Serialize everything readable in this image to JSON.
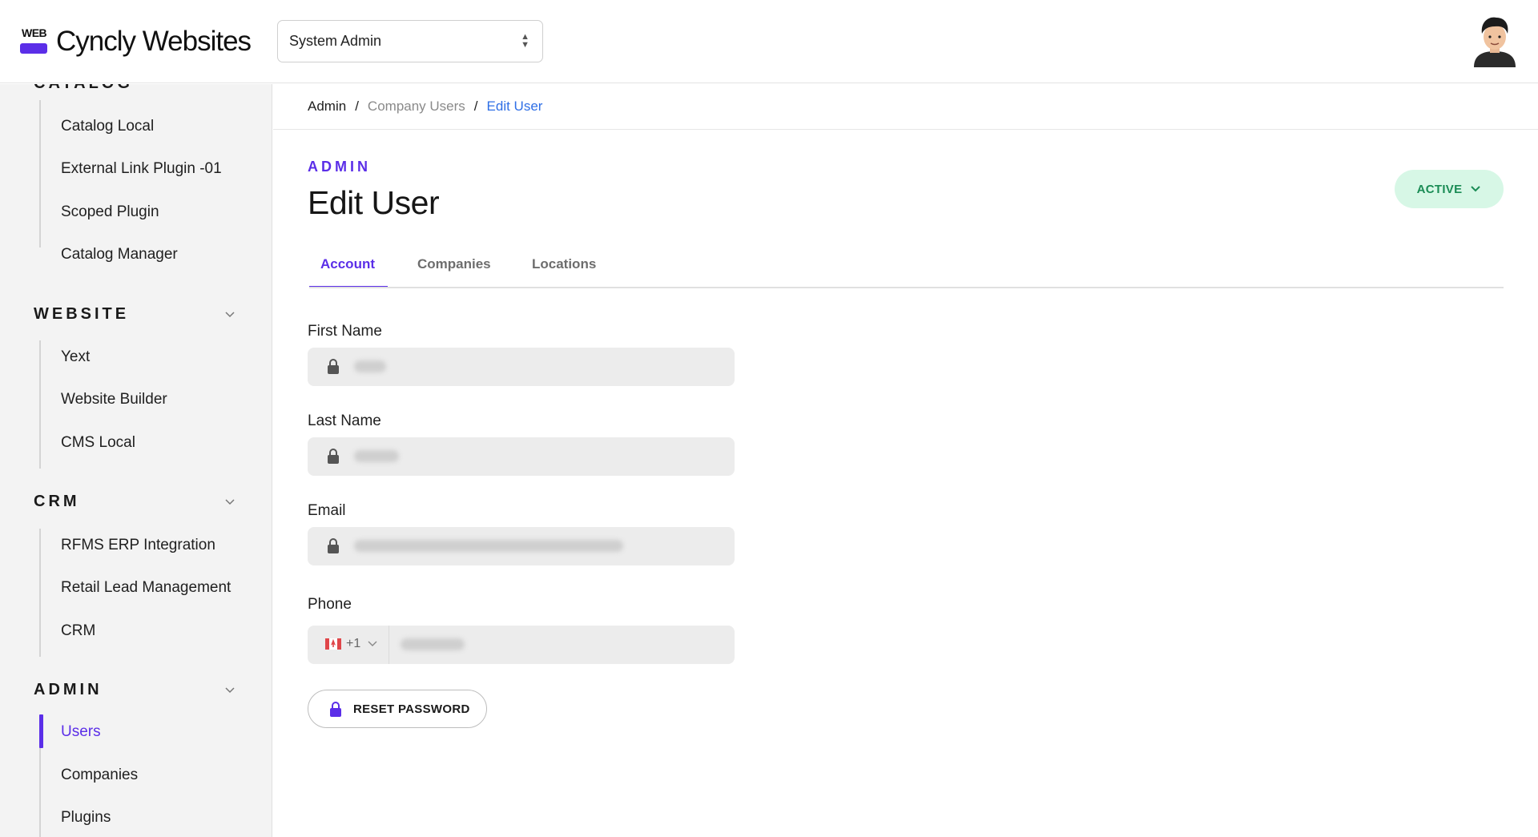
{
  "header": {
    "logo_mark": "WEB",
    "logo_text": "Cyncly Websites",
    "role_select": {
      "value": "System Admin"
    }
  },
  "sidebar": {
    "partial_section": "CATALOG",
    "catalog_items": [
      "Catalog Local",
      "External Link Plugin -01",
      "Scoped Plugin",
      "Catalog Manager"
    ],
    "sections": [
      {
        "title": "WEBSITE",
        "items": [
          "Yext",
          "Website Builder",
          "CMS Local"
        ]
      },
      {
        "title": "CRM",
        "items": [
          "RFMS ERP Integration",
          "Retail Lead Management",
          "CRM"
        ]
      },
      {
        "title": "ADMIN",
        "items": [
          "Users",
          "Companies",
          "Plugins"
        ]
      }
    ],
    "active_item": "Users"
  },
  "breadcrumb": {
    "items": [
      "Admin",
      "Company Users",
      "Edit User"
    ],
    "separator": "/"
  },
  "page": {
    "eyebrow": "ADMIN",
    "title": "Edit User",
    "status": "ACTIVE"
  },
  "tabs": [
    "Account",
    "Companies",
    "Locations"
  ],
  "active_tab": "Account",
  "form": {
    "first_name_label": "First Name",
    "last_name_label": "Last Name",
    "email_label": "Email",
    "phone_label": "Phone",
    "phone_country_code": "+1",
    "reset_password_label": "RESET PASSWORD"
  },
  "colors": {
    "accent": "#5b2ee8",
    "link": "#2f6fe6",
    "status_bg": "#d7f7e6",
    "status_text": "#1a8c55"
  },
  "icons": {
    "lock": "lock-icon",
    "chevron": "chevron-down-icon",
    "flag": "canada-flag-icon",
    "avatar": "user-avatar"
  }
}
